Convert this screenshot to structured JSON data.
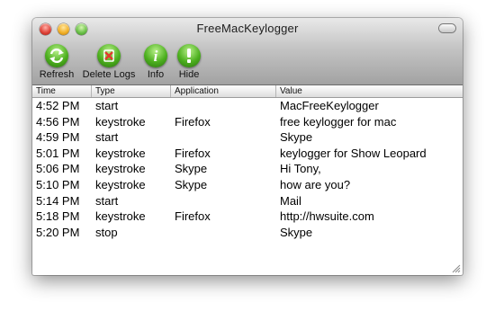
{
  "window": {
    "title": "FreeMacKeylogger"
  },
  "toolbar": {
    "refresh_label": "Refresh",
    "delete_label": "Delete Logs",
    "info_label": "Info",
    "hide_label": "Hide"
  },
  "columns": {
    "time": "Time",
    "type": "Type",
    "application": "Application",
    "value": "Value"
  },
  "rows": [
    {
      "time": "4:52 PM",
      "type": "start",
      "application": "",
      "value": "MacFreeKeylogger"
    },
    {
      "time": "4:56 PM",
      "type": "keystroke",
      "application": "Firefox",
      "value": "free keylogger for mac"
    },
    {
      "time": "4:59 PM",
      "type": "start",
      "application": "",
      "value": "Skype"
    },
    {
      "time": "5:01 PM",
      "type": "keystroke",
      "application": "Firefox",
      "value": "keylogger for Show Leopard"
    },
    {
      "time": "5:06 PM",
      "type": "keystroke",
      "application": "Skype",
      "value": "Hi Tony,"
    },
    {
      "time": "5:10 PM",
      "type": "keystroke",
      "application": "Skype",
      "value": "how are you?"
    },
    {
      "time": "5:14 PM",
      "type": "start",
      "application": "",
      "value": "Mail"
    },
    {
      "time": "5:18 PM",
      "type": "keystroke",
      "application": "Firefox",
      "value": "http://hwsuite.com"
    },
    {
      "time": "5:20 PM",
      "type": "stop",
      "application": "",
      "value": "Skype"
    }
  ],
  "icons": {
    "refresh": "refresh-arrows-icon",
    "delete": "delete-x-icon",
    "info": "info-i-icon",
    "hide": "hide-exclamation-icon"
  },
  "colors": {
    "toolbar_icon": "#4caf1e",
    "delete_mark": "#e23b2e"
  }
}
